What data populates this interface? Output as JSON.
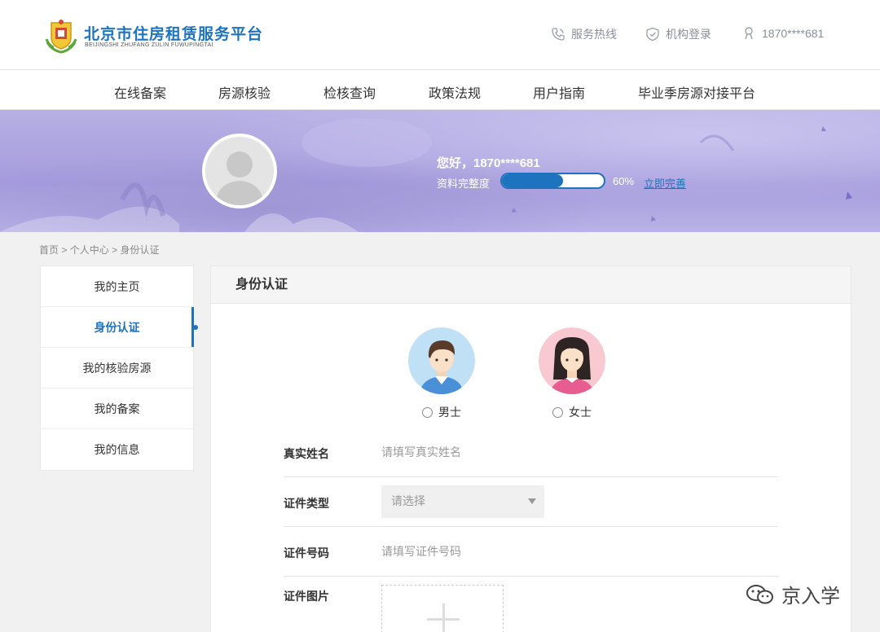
{
  "header": {
    "title": "北京市住房租赁服务平台",
    "subtitle": "BEIJINGSHI ZHUFANG ZULIN FUWUPINGTAI",
    "hotline": "服务热线",
    "org_login": "机构登录",
    "user": "1870****681"
  },
  "nav": {
    "items": [
      "在线备案",
      "房源核验",
      "检核查询",
      "政策法规",
      "用户指南",
      "毕业季房源对接平台"
    ]
  },
  "banner": {
    "greeting": "您好，1870****681",
    "completeness_label": "资料完整度",
    "completeness_value": 60,
    "completeness_text": "60%",
    "complete_link": "立即完善"
  },
  "breadcrumb": {
    "items": [
      "首页",
      "个人中心",
      "身份认证"
    ],
    "separator": ">"
  },
  "sidebar": {
    "items": [
      {
        "label": "我的主页",
        "active": false
      },
      {
        "label": "身份认证",
        "active": true
      },
      {
        "label": "我的核验房源",
        "active": false
      },
      {
        "label": "我的备案",
        "active": false
      },
      {
        "label": "我的信息",
        "active": false
      }
    ]
  },
  "panel": {
    "title": "身份认证",
    "gender": {
      "male": "男士",
      "female": "女士"
    },
    "fields": {
      "name_label": "真实姓名",
      "name_placeholder": "请填写真实姓名",
      "id_type_label": "证件类型",
      "id_type_value": "请选择",
      "id_number_label": "证件号码",
      "id_number_placeholder": "请填写证件号码",
      "id_image_label": "证件图片"
    }
  },
  "watermark": "京入学",
  "colors": {
    "brand": "#1e73be",
    "banner": "#aaa2de"
  }
}
